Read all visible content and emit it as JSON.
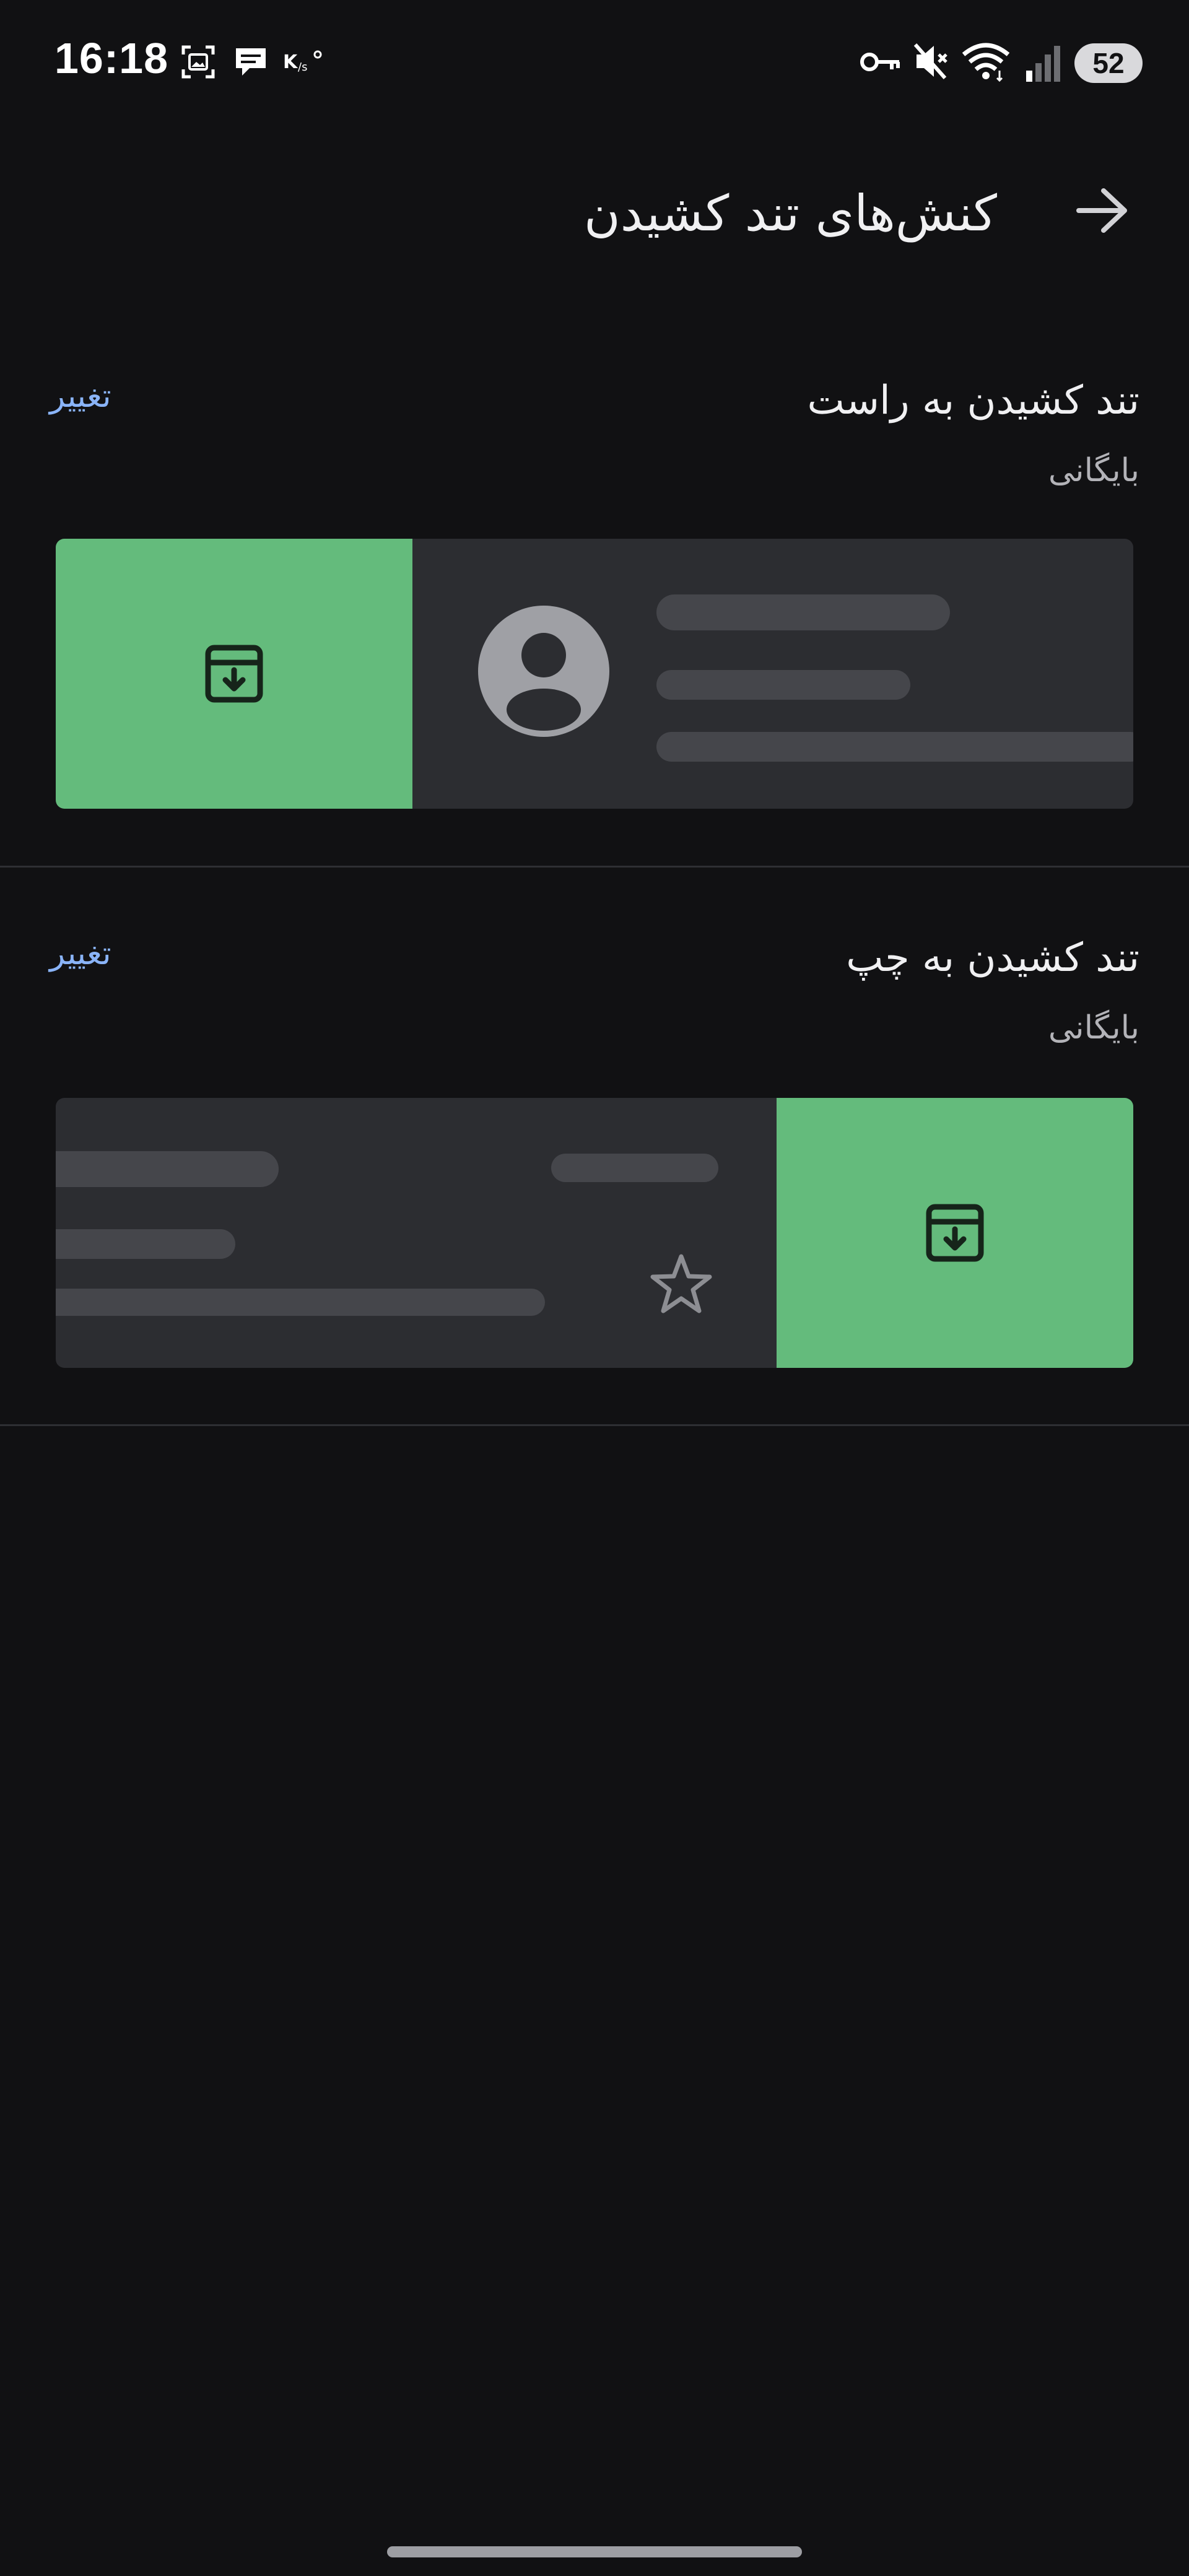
{
  "status_bar": {
    "time": "16:18",
    "left_icons": [
      "screenshot-icon",
      "chat-bubble-icon",
      "data-speed-icon"
    ],
    "right_icons": [
      "vpn-key-icon",
      "mute-icon",
      "wifi-icon",
      "signal-icon"
    ],
    "battery_level": "52"
  },
  "header": {
    "title": "کنش‌های تند کشیدن",
    "back_icon": "arrow-back-icon"
  },
  "sections": [
    {
      "title": "تند کشیدن به راست",
      "action": "بایگانی",
      "change_label": "تغییر",
      "action_icon": "archive-icon"
    },
    {
      "title": "تند کشیدن به چپ",
      "action": "بایگانی",
      "change_label": "تغییر",
      "action_icon": "archive-icon"
    }
  ],
  "colors": {
    "background": "#111113",
    "action_green": "#64bb7c",
    "link_blue": "#8ab4f8",
    "preview_card": "#2c2d31"
  }
}
